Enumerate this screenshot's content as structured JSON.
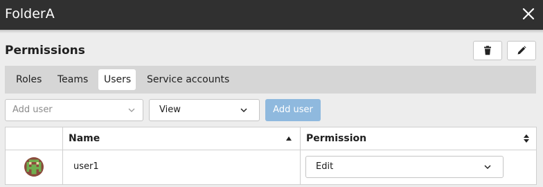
{
  "dialog": {
    "title": "FolderA",
    "close_icon": "close-icon"
  },
  "panel": {
    "heading": "Permissions",
    "delete_icon": "trash-icon",
    "edit_icon": "pencil-icon"
  },
  "tabs": [
    {
      "label": "Roles",
      "active": false
    },
    {
      "label": "Teams",
      "active": false
    },
    {
      "label": "Users",
      "active": true
    },
    {
      "label": "Service accounts",
      "active": false
    }
  ],
  "add_form": {
    "user_placeholder": "Add user",
    "permission_value": "View",
    "add_button_label": "Add user"
  },
  "table": {
    "columns": [
      {
        "label": "Name",
        "sort_icon": "sort-up-icon"
      },
      {
        "label": "Permission",
        "sort_icon": "sort-both-icon"
      }
    ],
    "rows": [
      {
        "avatar_icon": "pixel-avatar-icon",
        "name": "user1",
        "permission": "Edit"
      }
    ]
  },
  "colors": {
    "titlebar": "#303030",
    "tabbar": "#d6d6d6",
    "primary_button_disabled": "#8fb9de",
    "avatar_bg": "#8b4a3c",
    "avatar_fg": "#6fae4f"
  }
}
